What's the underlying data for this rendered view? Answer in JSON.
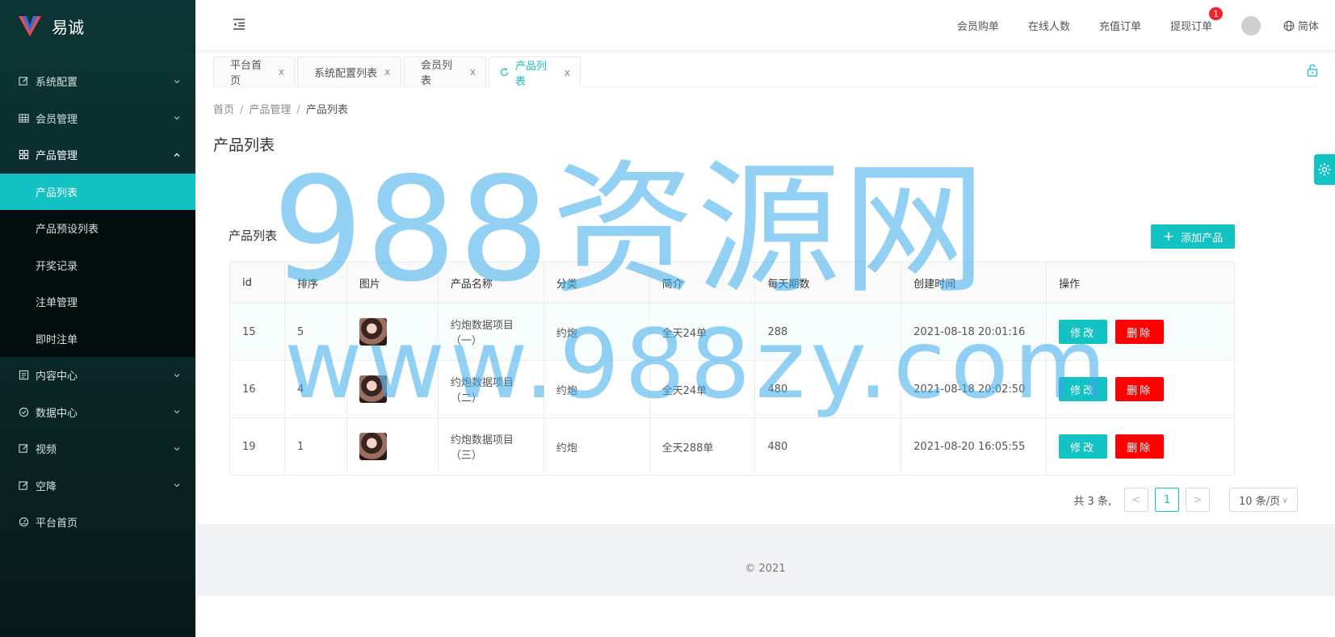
{
  "app": {
    "name": "易诚"
  },
  "sidebar": {
    "items": [
      {
        "label": "系统配置",
        "icon": "edit-icon"
      },
      {
        "label": "会员管理",
        "icon": "table-icon"
      },
      {
        "label": "产品管理",
        "icon": "appstore-icon",
        "open": true,
        "children": [
          {
            "label": "产品列表",
            "active": true
          },
          {
            "label": "产品预设列表"
          },
          {
            "label": "开奖记录"
          },
          {
            "label": "注单管理"
          },
          {
            "label": "即时注单"
          }
        ]
      },
      {
        "label": "内容中心",
        "icon": "profile-icon"
      },
      {
        "label": "数据中心",
        "icon": "check-circle-icon"
      },
      {
        "label": "视频",
        "icon": "edit-icon"
      },
      {
        "label": "空降",
        "icon": "edit-icon"
      },
      {
        "label": "平台首页",
        "icon": "dashboard-icon"
      }
    ]
  },
  "header": {
    "links": [
      "会员购单",
      "在线人数",
      "充值订单",
      "提现订单"
    ],
    "withdraw_badge": "1",
    "lang": "简体"
  },
  "tabs": [
    {
      "label": "平台首页",
      "close": "x"
    },
    {
      "label": "系统配置列表",
      "close": "x"
    },
    {
      "label": "会员列表",
      "close": "x"
    },
    {
      "label": "产品列表",
      "close": "x",
      "active": true
    }
  ],
  "breadcrumb": {
    "home": "首页",
    "parent": "产品管理",
    "current": "产品列表",
    "sep": "/"
  },
  "page_title": "产品列表",
  "card": {
    "title": "产品列表",
    "add_button": "添加产品",
    "add_plus": "+"
  },
  "table": {
    "columns": [
      "id",
      "排序",
      "图片",
      "产品名称",
      "分类",
      "简介",
      "每天期数",
      "创建时间",
      "操作"
    ],
    "rows": [
      {
        "id": "15",
        "sort": "5",
        "name": "约炮数据项目（一）",
        "category": "约炮",
        "intro": "全天24单",
        "periods": "288",
        "created": "2021-08-18 20:01:16"
      },
      {
        "id": "16",
        "sort": "4",
        "name": "约炮数据项目（二）",
        "category": "约炮",
        "intro": "全天24单",
        "periods": "480",
        "created": "2021-08-18 20:02:50"
      },
      {
        "id": "19",
        "sort": "1",
        "name": "约炮数据项目（三）",
        "category": "约炮",
        "intro": "全天288单",
        "periods": "480",
        "created": "2021-08-20 16:05:55"
      }
    ],
    "edit_label": "修改",
    "delete_label": "删除"
  },
  "pagination": {
    "total": "共 3 条,",
    "current": "1",
    "prev": "<",
    "next": ">",
    "page_size": "10 条/页",
    "size_chevron": "∨"
  },
  "footer": {
    "text": "© 2021"
  },
  "watermark": {
    "line1": "988资源网",
    "line2": "www.988zy.com"
  },
  "colors": {
    "accent": "#13c2c2",
    "danger": "#ff0000",
    "sidebar_bg": "#0b2b2b",
    "badge": "#f5222d"
  }
}
